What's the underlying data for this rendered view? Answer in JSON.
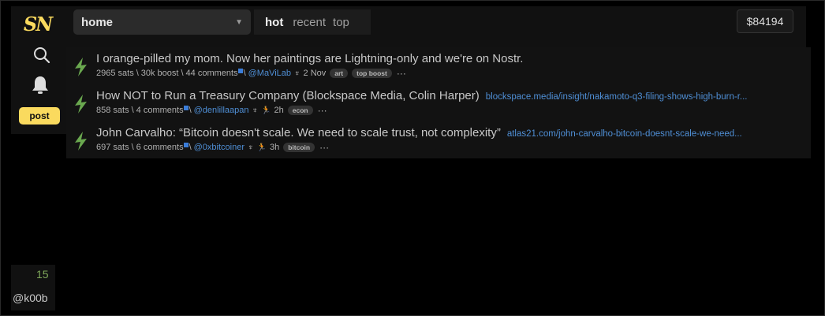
{
  "app": {
    "logo": "SN"
  },
  "sidebar": {
    "post_label": "post"
  },
  "header": {
    "territory": "home",
    "tabs": [
      {
        "label": "hot",
        "active": true
      },
      {
        "label": "recent",
        "active": false
      },
      {
        "label": "top",
        "active": false
      }
    ],
    "price": "$84194"
  },
  "items": [
    {
      "title": "I orange-pilled my mom. Now her paintings are Lightning-only and we're on Nostr.",
      "link": "",
      "sats": "2965 sats",
      "boost": "30k boost",
      "comments": "44 comments",
      "user": "@MaViLab",
      "time": "2 Nov",
      "tags": [
        "art",
        "top boost"
      ]
    },
    {
      "title": "How NOT to Run a Treasury Company (Blockspace Media, Colin Harper)",
      "link": "blockspace.media/insight/nakamoto-q3-filing-shows-high-burn-r...",
      "sats": "858 sats",
      "boost": "",
      "comments": "4 comments",
      "user": "@denlillaapan",
      "time": "2h",
      "tags": [
        "econ"
      ]
    },
    {
      "title": "John Carvalho: “Bitcoin doesn't scale. We need to scale trust, not complexity”",
      "link": "atlas21.com/john-carvalho-bitcoin-doesnt-scale-we-need...",
      "sats": "697 sats",
      "boost": "",
      "comments": "6 comments",
      "user": "@0xbitcoiner",
      "time": "3h",
      "tags": [
        "bitcoin"
      ]
    }
  ],
  "footer": {
    "count": "15",
    "user": "@k00b"
  },
  "colors": {
    "accent": "#fada5e",
    "link": "#4f8fd6",
    "bolt": "#6aa84f",
    "background": "#000000"
  }
}
